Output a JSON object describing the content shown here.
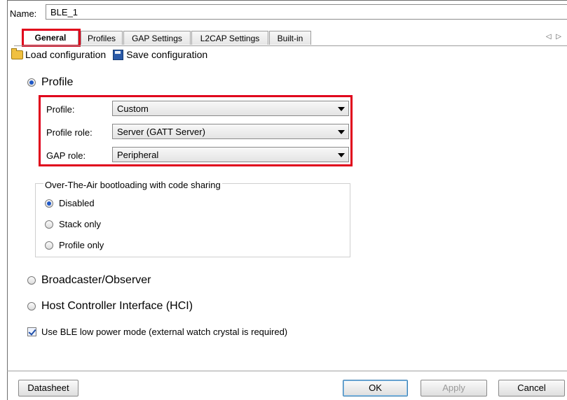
{
  "name": {
    "label": "Name:",
    "value": "BLE_1"
  },
  "tabs": [
    {
      "label": "General",
      "active": true
    },
    {
      "label": "Profiles"
    },
    {
      "label": "GAP Settings"
    },
    {
      "label": "L2CAP Settings"
    },
    {
      "label": "Built-in"
    }
  ],
  "tab_scroll_glyph": "◁ ▷",
  "toolbar": {
    "load_label": "Load configuration",
    "save_label": "Save configuration"
  },
  "mode": {
    "profile_label": "Profile",
    "broadcaster_label": "Broadcaster/Observer",
    "hci_label": "Host Controller Interface (HCI)",
    "selected": "Profile"
  },
  "profile_settings": {
    "profile_label": "Profile:",
    "profile_value": "Custom",
    "role_label": "Profile role:",
    "role_value": "Server (GATT Server)",
    "gap_label": "GAP role:",
    "gap_value": "Peripheral"
  },
  "ota": {
    "title": "Over-The-Air bootloading with code sharing",
    "options": [
      "Disabled",
      "Stack only",
      "Profile only"
    ],
    "selected": "Disabled"
  },
  "low_power": {
    "label": "Use BLE low power mode (external watch crystal is required)",
    "checked": true
  },
  "footer": {
    "datasheet": "Datasheet",
    "ok": "OK",
    "apply": "Apply",
    "cancel": "Cancel"
  },
  "colors": {
    "highlight": "#e0001b",
    "accent": "#1f58c7"
  }
}
